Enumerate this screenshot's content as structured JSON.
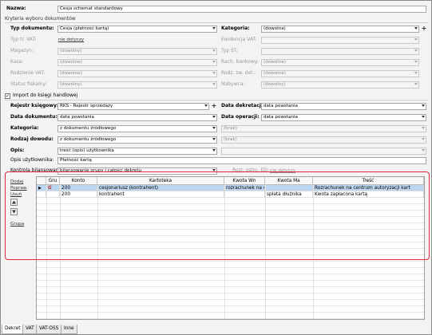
{
  "header": {
    "name_label": "Nazwa:",
    "name_value": "Cesja schemat standardowy"
  },
  "criteria": {
    "section_title": "Kryteria wyboru dokumentów",
    "left": [
      {
        "label": "Typ dokumentu:",
        "value": "Cesja (płatność kartą)",
        "kind": "combo",
        "enabled": true
      },
      {
        "label": "Typ tr. VAT:",
        "value": "nie dotyczy",
        "kind": "link",
        "enabled": false
      },
      {
        "label": "Magazyn:",
        "value": "(dowolny)",
        "kind": "combo",
        "enabled": false
      },
      {
        "label": "Kasa:",
        "value": "(dowolne)",
        "kind": "combo",
        "enabled": false
      },
      {
        "label": "Rodzienie VAT:",
        "value": "(dowolne)",
        "kind": "combo",
        "enabled": false
      },
      {
        "label": "Status fiskalny:",
        "value": "(dowolny)",
        "kind": "combo",
        "enabled": false
      }
    ],
    "right": [
      {
        "label": "Kategoria:",
        "value": "(dowolna)",
        "kind": "combo",
        "enabled": true
      },
      {
        "label": "Ewidencja VAT:",
        "value": "",
        "kind": "combo",
        "enabled": false
      },
      {
        "label": "Typ ŚT:",
        "value": "",
        "kind": "combo",
        "enabled": false
      },
      {
        "label": "Rach. bankowy:",
        "value": "(dowolne)",
        "kind": "combo",
        "enabled": false
      },
      {
        "label": "Rodz. zw. det.:",
        "value": "(dowolne)",
        "kind": "combo",
        "enabled": false
      },
      {
        "label": "Nabywca:",
        "value": "(dowolny)",
        "kind": "combo",
        "enabled": false
      }
    ]
  },
  "import": {
    "checkbox_label": "Import do księgi handlowej",
    "checked": true,
    "left": [
      {
        "label": "Rejestr księgowy:",
        "value": "RKS - Rejestr sprzedaży",
        "enabled": true,
        "plus": true
      },
      {
        "label": "Data dokumentu:",
        "value": "data powstania",
        "enabled": true,
        "plus": false
      },
      {
        "label": "Kategoria:",
        "value": "z dokumentu źródłowego",
        "enabled": true,
        "plus": false
      },
      {
        "label": "Rodzaj dowodu:",
        "value": "z dokumentu źródłowego",
        "enabled": true,
        "plus": false
      },
      {
        "label": "Opis:",
        "value": "treść (opis) użytkownika",
        "enabled": true,
        "plus": false
      }
    ],
    "right": [
      {
        "label": "Data dekretacji:",
        "value": "data powstania",
        "enabled": true
      },
      {
        "label": "Data operacji:",
        "value": "data powstania",
        "enabled": true
      },
      {
        "label": "",
        "value": "(brak)",
        "enabled": false
      },
      {
        "label": "",
        "value": "(brak)",
        "enabled": false
      },
      {
        "label": "",
        "value": "",
        "enabled": false
      }
    ],
    "user_desc_label": "Opis użytkownika:",
    "user_desc_value": "Płatność kartą",
    "control_label": "Kontrola bilansowania:",
    "control_value": "bilansowanie grupy i całości dekretu",
    "rozr_label": "Rozr. ostro. ED:",
    "rozr_value": "nie dotyczy"
  },
  "side_actions": {
    "add": "Dodaj",
    "edit": "Popraw",
    "delete": "Usuń",
    "group": "Grupa"
  },
  "grid": {
    "columns": [
      "Gru",
      "Konto",
      "Kartoteka",
      "Kwota Wn",
      "Kwota Ma",
      "Treść"
    ],
    "rows": [
      {
        "marker": "▶",
        "icon": "G",
        "konto": "200",
        "kartoteka": "cesjonariusz (kontrahent)",
        "kwota_wn": "rozrachunek na c",
        "kwota_ma": "",
        "tresc": "Rozrachunek na centrum autoryzacji kart",
        "selected": true
      },
      {
        "marker": "",
        "icon": "",
        "konto": "200",
        "kartoteka": "kontrahent",
        "kwota_wn": "",
        "kwota_ma": "spłata dłużnika",
        "tresc": "Kwota zapłacona kartą",
        "selected": false
      }
    ]
  },
  "tabs": [
    "Dekret",
    "VAT",
    "VAT-OSS",
    "Inne"
  ],
  "colors": {
    "highlight": "#e0283a",
    "selected_row": "#bcd6f2"
  }
}
